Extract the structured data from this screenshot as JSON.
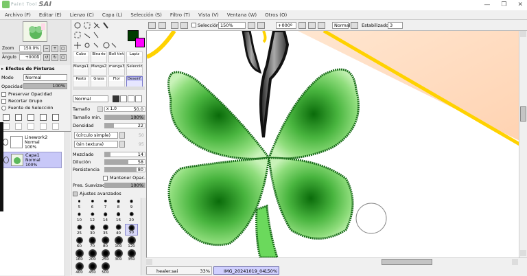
{
  "app": {
    "logo_sub": "Paint Tool",
    "logo_main": "SAI"
  },
  "menu": [
    "Archivo (F)",
    "Editar (E)",
    "Lienzo (C)",
    "Capa (L)",
    "Selección (S)",
    "Filtro (T)",
    "Vista (V)",
    "Ventana (W)",
    "Otros (O)"
  ],
  "navigator": {
    "zoom_label": "Zoom",
    "zoom_value": "150.0%",
    "angle_label": "Ángulo",
    "angle_value": "+000ß"
  },
  "layer_panel": {
    "effects_title": "Efectos de Pinturas",
    "mode_label": "Modo",
    "mode_value": "Normal",
    "opacity_label": "Opacidad",
    "opacity_value": "100%",
    "preserve_opacity": "Preservar Opacidad",
    "clip_group": "Recortar Grupo",
    "selection_source": "Fuente de Selección",
    "layers": [
      {
        "name": "Linework2",
        "mode": "Normal",
        "opacity": "100%"
      },
      {
        "name": "Capa1",
        "mode": "Normal",
        "opacity": "100%"
      }
    ]
  },
  "colors": {
    "primary": "#003b00",
    "secondary": "#ff00ff",
    "accent_selection": "#c8c8f8"
  },
  "tools": {
    "row1": [
      "Cubo",
      "Binario",
      "Boli tinta",
      "Lapiz"
    ],
    "row2": [
      "Manga1",
      "Manga2",
      "manga3",
      "Selecció"
    ],
    "row3": [
      "Pasto",
      "Grass",
      "Flor",
      "Desenf."
    ],
    "active_tool": "Desenf."
  },
  "brush": {
    "blend_mode": "Normal",
    "size_label": "Tamaño",
    "size_mult": "x 1.0",
    "size_value": "50.0",
    "min_size_label": "Tamaño min.",
    "min_size_value": "100%",
    "density_label": "Densidad",
    "density_value": "22",
    "shape_value": "(círculo simple)",
    "shape_num": "50",
    "texture_value": "(sin textura)",
    "texture_num": "95",
    "blend_label": "Mezclado",
    "blend_value": "14",
    "dilution_label": "Dilución",
    "dilution_value": "58",
    "persistence_label": "Persistencia",
    "persistence_value": "80",
    "keep_opacity_label": "Mantener Opac.",
    "smooth_label": "Pres. Suavizado",
    "smooth_value": "100%",
    "advanced_label": "Ajustes avanzados",
    "density_fraction": 0.22,
    "blend_fraction": 0.14,
    "dilution_fraction": 0.58,
    "persistence_fraction": 0.8,
    "size_presets": [
      "5",
      "6",
      "7",
      "8",
      "9",
      "10",
      "12",
      "14",
      "16",
      "20",
      "25",
      "30",
      "35",
      "40",
      "50",
      "60",
      "70",
      "80",
      "100",
      "120",
      "160",
      "200",
      "250",
      "300",
      "350",
      "400",
      "450",
      "500"
    ],
    "active_size": "50"
  },
  "canvas_toolbar": {
    "selection_label": "Selección",
    "zoom_value": "150%",
    "angle_value": "+000º",
    "mode_value": "Normal",
    "stabilizer_label": "Estabilizador",
    "stabilizer_value": "3"
  },
  "documents": [
    {
      "name": "healer.sai",
      "zoom": "33%"
    },
    {
      "name": "IMG_20241019_04...",
      "zoom": "150%"
    }
  ]
}
